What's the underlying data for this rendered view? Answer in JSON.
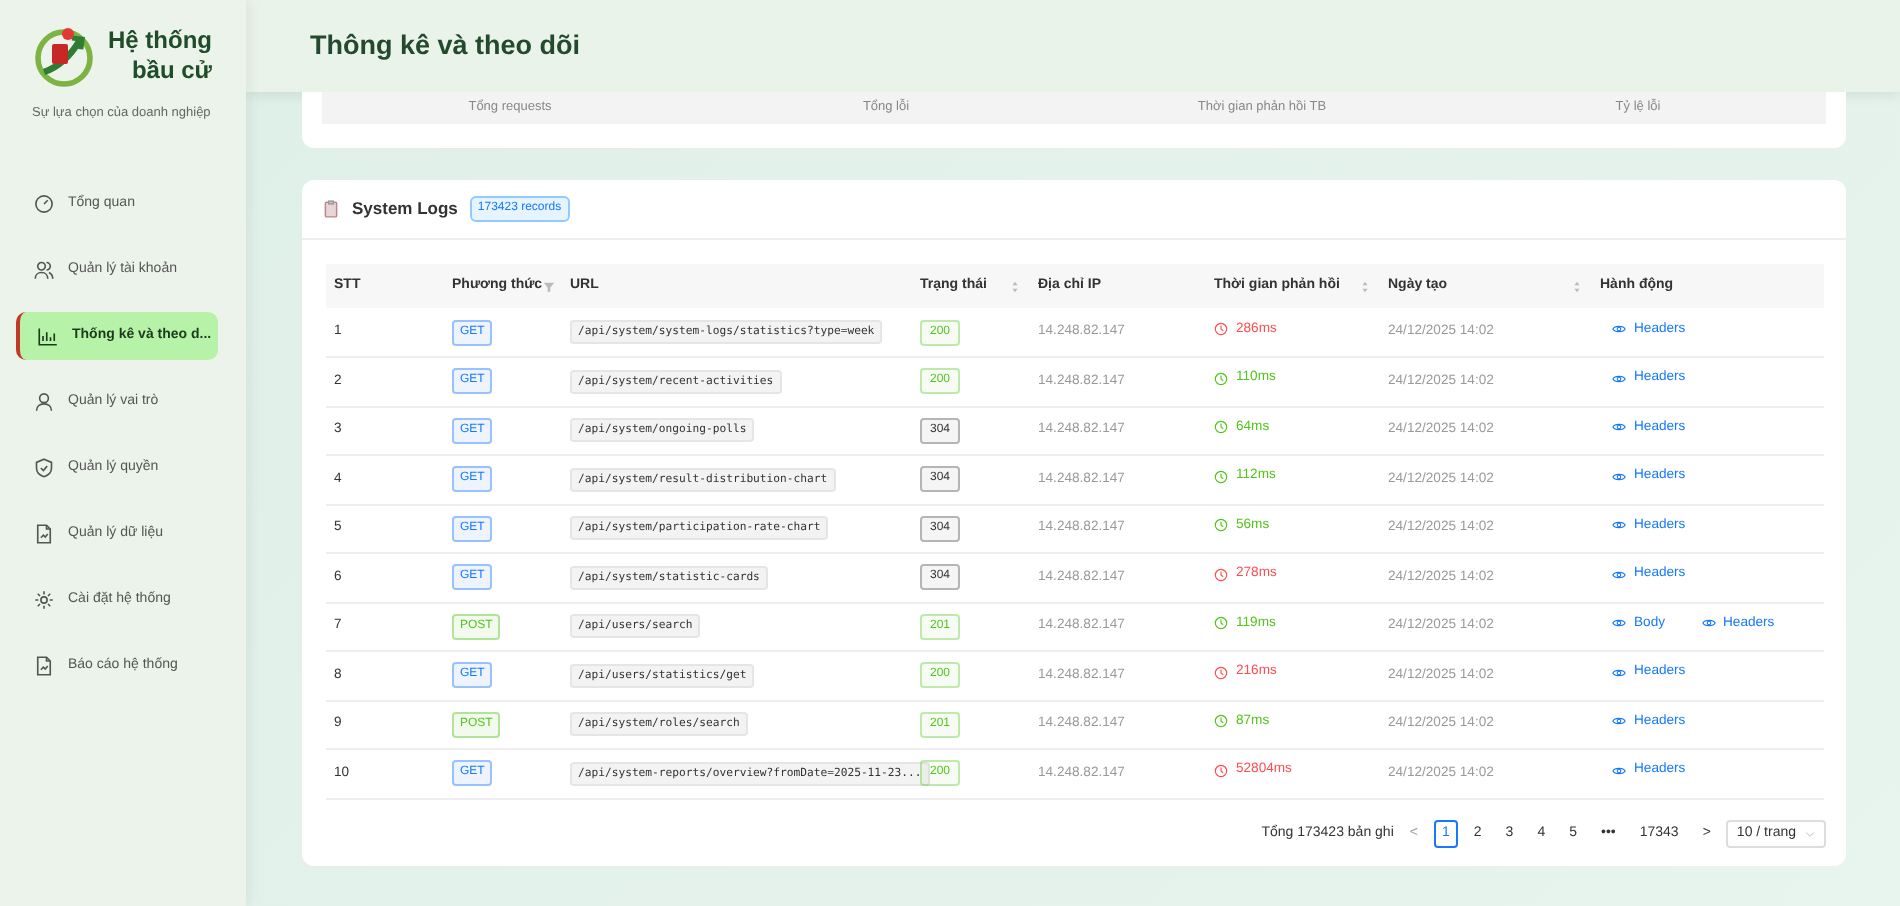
{
  "sidebar": {
    "brand": {
      "title_line_1": "Hệ thống",
      "title_line_2": "bầu cử",
      "tagline": "Sự lựa chọn của doanh nghiệp"
    },
    "items": [
      {
        "label": "Tổng quan",
        "selected": false
      },
      {
        "label": "Quản lý tài khoản",
        "selected": false
      },
      {
        "label": "Thống kê và theo d...",
        "selected": true
      },
      {
        "label": "Quản lý vai trò",
        "selected": false
      },
      {
        "label": "Quản lý quyền",
        "selected": false
      },
      {
        "label": "Quản lý dữ liệu",
        "selected": false
      },
      {
        "label": "Cài đặt hệ thống",
        "selected": false
      },
      {
        "label": "Báo cáo hệ thống",
        "selected": false
      }
    ]
  },
  "header": {
    "title": "Thông kê và theo dõi"
  },
  "stats": {
    "labels": [
      "Tổng requests",
      "Tổng lỗi",
      "Thời gian phản hồi TB",
      "Tỷ lệ lỗi"
    ]
  },
  "logs": {
    "title": "System Logs",
    "count_badge": "173423 records",
    "columns": [
      {
        "label": "STT",
        "kind": "plain"
      },
      {
        "label": "Phương thức",
        "kind": "filter"
      },
      {
        "label": "URL",
        "kind": "plain"
      },
      {
        "label": "Trạng thái",
        "kind": "sort"
      },
      {
        "label": "Địa chỉ IP",
        "kind": "plain"
      },
      {
        "label": "Thời gian phản hồi",
        "kind": "sort"
      },
      {
        "label": "Ngày tạo",
        "kind": "sort"
      },
      {
        "label": "Hành động",
        "kind": "plain"
      }
    ],
    "rows": [
      {
        "stt": "1",
        "method": {
          "text": "GET",
          "color": "#1677ff"
        },
        "url": "/api/system/system-logs/statistics?type=week",
        "status": {
          "text": "200",
          "color": "#52c41a"
        },
        "ip": "14.248.82.147",
        "time": {
          "text": "286ms",
          "color": "#ff4d4f"
        },
        "date": "24/12/2025 14:02",
        "actions": [
          "Headers"
        ]
      },
      {
        "stt": "2",
        "method": {
          "text": "GET",
          "color": "#1677ff"
        },
        "url": "/api/system/recent-activities",
        "status": {
          "text": "200",
          "color": "#52c41a"
        },
        "ip": "14.248.82.147",
        "time": {
          "text": "110ms",
          "color": "#52c41a"
        },
        "date": "24/12/2025 14:02",
        "actions": [
          "Headers"
        ]
      },
      {
        "stt": "3",
        "method": {
          "text": "GET",
          "color": "#1677ff"
        },
        "url": "/api/system/ongoing-polls",
        "status": {
          "text": "304",
          "color": "#333333"
        },
        "ip": "14.248.82.147",
        "time": {
          "text": "64ms",
          "color": "#52c41a"
        },
        "date": "24/12/2025 14:02",
        "actions": [
          "Headers"
        ]
      },
      {
        "stt": "4",
        "method": {
          "text": "GET",
          "color": "#1677ff"
        },
        "url": "/api/system/result-distribution-chart",
        "status": {
          "text": "304",
          "color": "#333333"
        },
        "ip": "14.248.82.147",
        "time": {
          "text": "112ms",
          "color": "#52c41a"
        },
        "date": "24/12/2025 14:02",
        "actions": [
          "Headers"
        ]
      },
      {
        "stt": "5",
        "method": {
          "text": "GET",
          "color": "#1677ff"
        },
        "url": "/api/system/participation-rate-chart",
        "status": {
          "text": "304",
          "color": "#333333"
        },
        "ip": "14.248.82.147",
        "time": {
          "text": "56ms",
          "color": "#52c41a"
        },
        "date": "24/12/2025 14:02",
        "actions": [
          "Headers"
        ]
      },
      {
        "stt": "6",
        "method": {
          "text": "GET",
          "color": "#1677ff"
        },
        "url": "/api/system/statistic-cards",
        "status": {
          "text": "304",
          "color": "#333333"
        },
        "ip": "14.248.82.147",
        "time": {
          "text": "278ms",
          "color": "#ff4d4f"
        },
        "date": "24/12/2025 14:02",
        "actions": [
          "Headers"
        ]
      },
      {
        "stt": "7",
        "method": {
          "text": "POST",
          "color": "#52c41a"
        },
        "url": "/api/users/search",
        "status": {
          "text": "201",
          "color": "#52c41a"
        },
        "ip": "14.248.82.147",
        "time": {
          "text": "119ms",
          "color": "#52c41a"
        },
        "date": "24/12/2025 14:02",
        "actions": [
          "Body",
          "Headers"
        ]
      },
      {
        "stt": "8",
        "method": {
          "text": "GET",
          "color": "#1677ff"
        },
        "url": "/api/users/statistics/get",
        "status": {
          "text": "200",
          "color": "#52c41a"
        },
        "ip": "14.248.82.147",
        "time": {
          "text": "216ms",
          "color": "#ff4d4f"
        },
        "date": "24/12/2025 14:02",
        "actions": [
          "Headers"
        ]
      },
      {
        "stt": "9",
        "method": {
          "text": "POST",
          "color": "#52c41a"
        },
        "url": "/api/system/roles/search",
        "status": {
          "text": "201",
          "color": "#52c41a"
        },
        "ip": "14.248.82.147",
        "time": {
          "text": "87ms",
          "color": "#52c41a"
        },
        "date": "24/12/2025 14:02",
        "actions": [
          "Headers"
        ]
      },
      {
        "stt": "10",
        "method": {
          "text": "GET",
          "color": "#1677ff"
        },
        "url": "/api/system-reports/overview?fromDate=2025-11-23...",
        "status": {
          "text": "200",
          "color": "#52c41a"
        },
        "ip": "14.248.82.147",
        "time": {
          "text": "52804ms",
          "color": "#ff4d4f"
        },
        "date": "24/12/2025 14:02",
        "actions": [
          "Headers"
        ]
      }
    ],
    "pagination": {
      "total": "Tổng 173423 bản ghi",
      "prev": "<",
      "pages": [
        {
          "label": "1",
          "selected": true
        },
        {
          "label": "2",
          "selected": false
        },
        {
          "label": "3",
          "selected": false
        },
        {
          "label": "4",
          "selected": false
        },
        {
          "label": "5",
          "selected": false
        },
        {
          "label": "•••",
          "selected": false
        },
        {
          "label": "17343",
          "selected": false
        }
      ],
      "next": ">",
      "page_size": "10 / trang"
    }
  }
}
